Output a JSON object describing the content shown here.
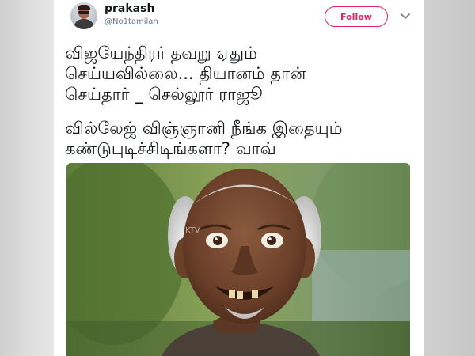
{
  "tweet": {
    "author": {
      "name": "prakash",
      "handle": "@No1tamilan"
    },
    "follow_label": "Follow",
    "text_lines": [
      "விஜயேந்திரர் தவறு ஏதும்",
      "செய்யவில்லை... தியானம் தான்",
      "செய்தார் _  செல்லூர் ராஜூ",
      "வில்லேஜ் விஞ்ஞானி நீங்க இதையும்",
      "கண்டுபுடிச்சிடிங்களா?  வாவ்"
    ],
    "media": {
      "watermark": "KTV",
      "description_icon": "photo-of-smiling-old-man"
    }
  },
  "colors": {
    "follow_accent": "#e0245e",
    "text_primary": "#14171a",
    "text_secondary": "#657786",
    "card_background": "#ffffff",
    "page_background": "#d6d6d6"
  }
}
